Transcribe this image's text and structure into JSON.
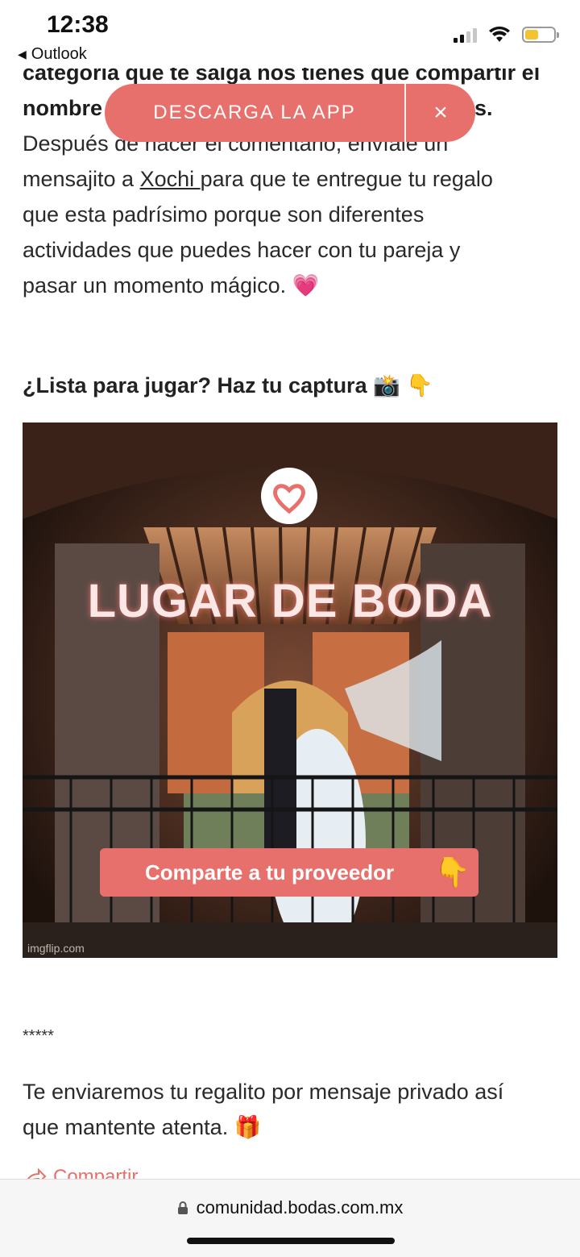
{
  "status_bar": {
    "time": "12:38",
    "back_app": "Outlook",
    "icons": [
      "signal-icon",
      "wifi-icon",
      "battery-icon"
    ]
  },
  "banner": {
    "label": "DESCARGA LA APP",
    "close": "×",
    "color": "#e8706c"
  },
  "article": {
    "line1_bold": "categoría que te salga nos tienes que compartir el",
    "line2_bold_start": "nombre",
    "line2_bold_end": "s.",
    "line3": "Después de hacer el comentario, envíale un",
    "line4_before": "mensajito a ",
    "line4_link": "Xochi ",
    "line4_after": "para que te entregue tu regalo",
    "line5": "que esta padrísimo porque son diferentes",
    "line6": "actividades que puedes hacer con tu pareja y",
    "line7": "pasar un momento mágico. 💗",
    "heading": "¿Lista para jugar? Haz tu captura 📸 👇",
    "gif_title": "LUGAR DE BODA",
    "gif_cta": "Comparte a tu proveedor",
    "gif_cta_icon": "👇",
    "gif_watermark": "imgflip.com",
    "separator": "*****",
    "closing_line1": "Te enviaremos tu regalito por mensaje privado así",
    "closing_line2": "que mantente atenta. 🎁",
    "share_label": "Compartir"
  },
  "browser": {
    "url": "comunidad.bodas.com.mx"
  }
}
